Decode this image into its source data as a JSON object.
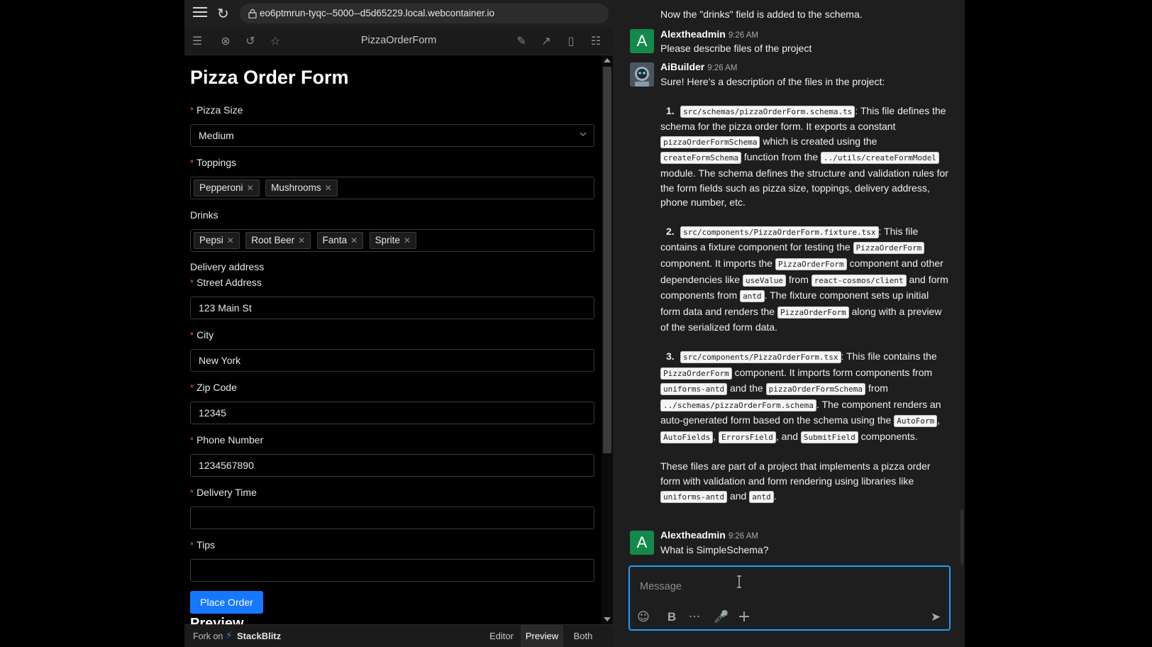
{
  "browser": {
    "url": "eo6ptmrun-tyqc--5000--d5d65229.local.webcontainer.io"
  },
  "stackblitz": {
    "project_title": "PizzaOrderForm",
    "footer": {
      "fork_label": "Fork on",
      "brand": "StackBlitz",
      "view_editor": "Editor",
      "view_preview": "Preview",
      "view_both": "Both",
      "active_view": "Preview"
    }
  },
  "form": {
    "title": "Pizza Order Form",
    "pizza_size": {
      "label": "Pizza Size",
      "value": "Medium"
    },
    "toppings": {
      "label": "Toppings",
      "tags": [
        "Pepperoni",
        "Mushrooms"
      ]
    },
    "drinks": {
      "label": "Drinks",
      "tags": [
        "Pepsi",
        "Root Beer",
        "Fanta",
        "Sprite"
      ]
    },
    "delivery_address_label": "Delivery address",
    "street": {
      "label": "Street Address",
      "value": "123 Main St"
    },
    "city": {
      "label": "City",
      "value": "New York"
    },
    "zip": {
      "label": "Zip Code",
      "value": "12345"
    },
    "phone": {
      "label": "Phone Number",
      "value": "1234567890"
    },
    "delivery_time": {
      "label": "Delivery Time",
      "value": ""
    },
    "tips": {
      "label": "Tips",
      "value": ""
    },
    "submit_label": "Place Order",
    "preview_heading": "Preview"
  },
  "chat": {
    "top_line": "Now the \"drinks\" field is added to the schema.",
    "messages": [
      {
        "author": "Alextheadmin",
        "avatar_letter": "A",
        "time": "9:26 AM",
        "text": "Please describe files of the project"
      },
      {
        "author": "AiBuilder",
        "time": "9:26 AM",
        "intro": "Sure! Here's a description of the files in the project:",
        "items": [
          {
            "num": "1.",
            "parts": [
              {
                "c": "src/schemas/pizzaOrderForm.schema.ts"
              },
              {
                "t": ": This file defines the schema for the pizza order form. It exports a constant "
              },
              {
                "c": "pizzaOrderFormSchema"
              },
              {
                "t": " which is created using the "
              },
              {
                "c": "createFormSchema"
              },
              {
                "t": " function from the "
              },
              {
                "c": "../utils/createFormModel"
              },
              {
                "t": " module. The schema defines the structure and validation rules for the form fields such as pizza size, toppings, delivery address, phone number, etc."
              }
            ]
          },
          {
            "num": "2.",
            "parts": [
              {
                "c": "src/components/PizzaOrderForm.fixture.tsx"
              },
              {
                "t": ": This file contains a fixture component for testing the "
              },
              {
                "c": "PizzaOrderForm"
              },
              {
                "t": " component. It imports the "
              },
              {
                "c": "PizzaOrderForm"
              },
              {
                "t": " component and other dependencies like "
              },
              {
                "c": "useValue"
              },
              {
                "t": " from "
              },
              {
                "c": "react-cosmos/client"
              },
              {
                "t": " and form components from "
              },
              {
                "c": "antd"
              },
              {
                "t": ". The fixture component sets up initial form data and renders the "
              },
              {
                "c": "PizzaOrderForm"
              },
              {
                "t": " along with a preview of the serialized form data."
              }
            ]
          },
          {
            "num": "3.",
            "parts": [
              {
                "c": "src/components/PizzaOrderForm.tsx"
              },
              {
                "t": ": This file contains the "
              },
              {
                "c": "PizzaOrderForm"
              },
              {
                "t": " component. It imports form components from "
              },
              {
                "c": "uniforms-antd"
              },
              {
                "t": " and the "
              },
              {
                "c": "pizzaOrderFormSchema"
              },
              {
                "t": " from "
              },
              {
                "c": "../schemas/pizzaOrderForm.schema"
              },
              {
                "t": ". The component renders an auto-generated form based on the schema using the "
              },
              {
                "c": "AutoForm"
              },
              {
                "t": ", "
              },
              {
                "c": "AutoFields"
              },
              {
                "t": ", "
              },
              {
                "c": "ErrorsField"
              },
              {
                "t": ", and "
              },
              {
                "c": "SubmitField"
              },
              {
                "t": " components."
              }
            ]
          }
        ],
        "outro": [
          {
            "t": "These files are part of a project that implements a pizza order form with validation and form rendering using libraries like "
          },
          {
            "c": "uniforms-antd"
          },
          {
            "t": " and "
          },
          {
            "c": "antd"
          },
          {
            "t": "."
          }
        ]
      },
      {
        "author": "Alextheadmin",
        "avatar_letter": "A",
        "time": "9:26 AM",
        "text": "What is SimpleSchema?"
      }
    ],
    "composer_placeholder": "Message"
  },
  "colors": {
    "accent": "#1677ff",
    "composer_border": "#1f9cff",
    "avatar_green": "#138a4a",
    "required": "#ff4d4f"
  },
  "icons": {
    "browser": [
      "hamburger-menu-icon",
      "reload-icon",
      "lock-icon"
    ],
    "toolbar": [
      "menu-icon",
      "close-circle-icon",
      "refresh-icon",
      "star-icon",
      "edit-icon",
      "external-link-icon",
      "device-icon",
      "settings-sliders-icon"
    ],
    "composer": [
      "emoji-icon",
      "bold-icon",
      "more-icon",
      "microphone-icon",
      "plus-icon",
      "send-icon"
    ]
  }
}
